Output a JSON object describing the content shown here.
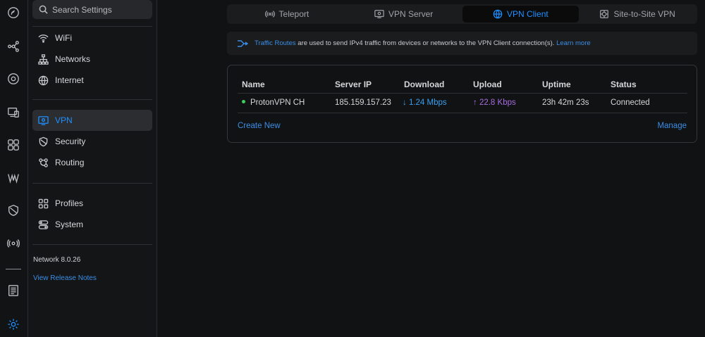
{
  "search": {
    "placeholder": "Search Settings"
  },
  "sidebar": {
    "group1": [
      {
        "label": "WiFi",
        "icon": "wifi-icon"
      },
      {
        "label": "Networks",
        "icon": "networks-icon"
      },
      {
        "label": "Internet",
        "icon": "globe-icon"
      }
    ],
    "group2": [
      {
        "label": "VPN",
        "icon": "vpn-icon",
        "active": true
      },
      {
        "label": "Security",
        "icon": "shield-icon"
      },
      {
        "label": "Routing",
        "icon": "routing-icon"
      }
    ],
    "group3": [
      {
        "label": "Profiles",
        "icon": "profiles-icon"
      },
      {
        "label": "System",
        "icon": "system-icon"
      }
    ],
    "version": "Network 8.0.26",
    "release_notes": "View Release Notes"
  },
  "tabs": [
    {
      "label": "Teleport",
      "icon": "teleport-icon"
    },
    {
      "label": "VPN Server",
      "icon": "vpn-server-icon"
    },
    {
      "label": "VPN Client",
      "icon": "vpn-client-icon",
      "active": true
    },
    {
      "label": "Site-to-Site VPN",
      "icon": "site-to-site-icon"
    }
  ],
  "banner": {
    "link": "Traffic Routes",
    "text": " are used to send IPv4 traffic from devices or networks to the VPN Client connection(s). ",
    "learn_more": "Learn more"
  },
  "table": {
    "headers": [
      "Name",
      "Server IP",
      "Download",
      "Upload",
      "Uptime",
      "Status"
    ],
    "rows": [
      {
        "name": "ProtonVPN CH",
        "server_ip": "185.159.157.23",
        "download": "↓ 1.24 Mbps",
        "upload": "↑ 22.8 Kbps",
        "uptime": "23h 42m 23s",
        "status": "Connected"
      }
    ],
    "create_new": "Create New",
    "manage": "Manage"
  },
  "colors": {
    "accent": "#1e90ff",
    "online": "#3ccf5a",
    "upload": "#a86ce0"
  }
}
